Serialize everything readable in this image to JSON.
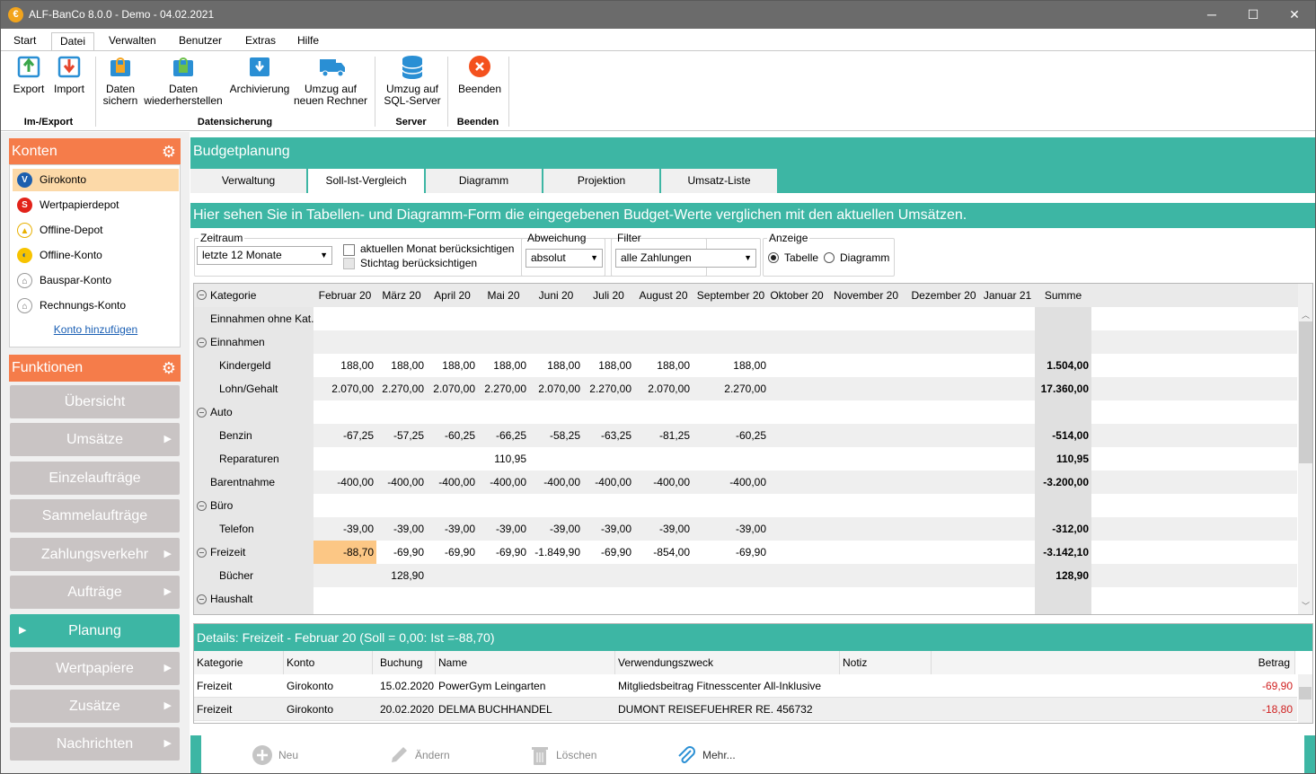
{
  "window": {
    "title": "ALF-BanCo 8.0.0 - Demo  -  04.02.2021",
    "min": "─",
    "max": "☐",
    "close": "✕"
  },
  "menu": [
    "Start",
    "Datei",
    "Verwalten",
    "Benutzer",
    "Extras",
    "Hilfe"
  ],
  "ribbon": {
    "export": "Export",
    "import": "Import",
    "sichern1": "Daten",
    "sichern2": "sichern",
    "wieder1": "Daten",
    "wieder2": "wiederherstellen",
    "archiv": "Archivierung",
    "umzug1": "Umzug auf",
    "umzug2": "neuen Rechner",
    "sql1": "Umzug auf",
    "sql2": "SQL-Server",
    "beenden": "Beenden",
    "groups": {
      "imexport": "Im-/Export",
      "datensicherung": "Datensicherung",
      "server": "Server",
      "beenden": "Beenden"
    }
  },
  "konten": {
    "title": "Konten",
    "items": [
      "Girokonto",
      "Wertpapierdepot",
      "Offline-Depot",
      "Offline-Konto",
      "Bauspar-Konto",
      "Rechnungs-Konto"
    ],
    "add": "Konto hinzufügen"
  },
  "funktionen": {
    "title": "Funktionen",
    "items": [
      "Übersicht",
      "Umsätze",
      "Einzelaufträge",
      "Sammelaufträge",
      "Zahlungsverkehr",
      "Aufträge",
      "Planung",
      "Wertpapiere",
      "Zusätze",
      "Nachrichten"
    ]
  },
  "budget": {
    "title": "Budgetplanung",
    "tabs": [
      "Verwaltung",
      "Soll-Ist-Vergleich",
      "Diagramm",
      "Projektion",
      "Umsatz-Liste"
    ],
    "info": "Hier sehen Sie in Tabellen- und Diagramm-Form die eingegebenen Budget-Werte verglichen mit den aktuellen Umsätzen."
  },
  "filters": {
    "zeitraum_label": "Zeitraum",
    "zeitraum_value": "letzte 12 Monate",
    "chk_monat": "aktuellen Monat berücksichtigen",
    "chk_stichtag": "Stichtag berücksichtigen",
    "abweichung_label": "Abweichung",
    "abweichung_value": "absolut",
    "filter_label": "Filter",
    "filter_value": "alle Zahlungen",
    "anzeige_label": "Anzeige",
    "radio_tabelle": "Tabelle",
    "radio_diagramm": "Diagramm"
  },
  "grid": {
    "headers": [
      "Kategorie",
      "Februar 20",
      "März 20",
      "April 20",
      "Mai 20",
      "Juni 20",
      "Juli 20",
      "August 20",
      "September 20",
      "Oktober 20",
      "November 20",
      "Dezember 20",
      "Januar 21",
      "Summe"
    ],
    "rows": [
      {
        "label": "Einnahmen ohne Kat.",
        "indent": 0,
        "group": false,
        "values": [
          "",
          "",
          "",
          "",
          "",
          "",
          "",
          "",
          "",
          "",
          "",
          "",
          ""
        ]
      },
      {
        "label": "Einnahmen",
        "indent": 0,
        "group": true,
        "values": [
          "",
          "",
          "",
          "",
          "",
          "",
          "",
          "",
          "",
          "",
          "",
          "",
          ""
        ]
      },
      {
        "label": "Kindergeld",
        "indent": 1,
        "group": false,
        "values": [
          "188,00",
          "188,00",
          "188,00",
          "188,00",
          "188,00",
          "188,00",
          "188,00",
          "188,00",
          "",
          "",
          "",
          "",
          "1.504,00"
        ]
      },
      {
        "label": "Lohn/Gehalt",
        "indent": 1,
        "group": false,
        "values": [
          "2.070,00",
          "2.270,00",
          "2.070,00",
          "2.270,00",
          "2.070,00",
          "2.270,00",
          "2.070,00",
          "2.270,00",
          "",
          "",
          "",
          "",
          "17.360,00"
        ]
      },
      {
        "label": "Auto",
        "indent": 0,
        "group": true,
        "values": [
          "",
          "",
          "",
          "",
          "",
          "",
          "",
          "",
          "",
          "",
          "",
          "",
          ""
        ]
      },
      {
        "label": "Benzin",
        "indent": 1,
        "group": false,
        "values": [
          "-67,25",
          "-57,25",
          "-60,25",
          "-66,25",
          "-58,25",
          "-63,25",
          "-81,25",
          "-60,25",
          "",
          "",
          "",
          "",
          "-514,00"
        ]
      },
      {
        "label": "Reparaturen",
        "indent": 1,
        "group": false,
        "values": [
          "",
          "",
          "",
          "110,95",
          "",
          "",
          "",
          "",
          "",
          "",
          "",
          "",
          "110,95"
        ]
      },
      {
        "label": "Barentnahme",
        "indent": 0,
        "group": false,
        "values": [
          "-400,00",
          "-400,00",
          "-400,00",
          "-400,00",
          "-400,00",
          "-400,00",
          "-400,00",
          "-400,00",
          "",
          "",
          "",
          "",
          "-3.200,00"
        ]
      },
      {
        "label": "Büro",
        "indent": 0,
        "group": true,
        "values": [
          "",
          "",
          "",
          "",
          "",
          "",
          "",
          "",
          "",
          "",
          "",
          "",
          ""
        ]
      },
      {
        "label": "Telefon",
        "indent": 1,
        "group": false,
        "values": [
          "-39,00",
          "-39,00",
          "-39,00",
          "-39,00",
          "-39,00",
          "-39,00",
          "-39,00",
          "-39,00",
          "",
          "",
          "",
          "",
          "-312,00"
        ]
      },
      {
        "label": "Freizeit",
        "indent": 0,
        "group": true,
        "values": [
          "-88,70",
          "-69,90",
          "-69,90",
          "-69,90",
          "-1.849,90",
          "-69,90",
          "-854,00",
          "-69,90",
          "",
          "",
          "",
          "",
          "-3.142,10"
        ]
      },
      {
        "label": "Bücher",
        "indent": 1,
        "group": false,
        "values": [
          "",
          "128,90",
          "",
          "",
          "",
          "",
          "",
          "",
          "",
          "",
          "",
          "",
          "128,90"
        ]
      },
      {
        "label": "Haushalt",
        "indent": 0,
        "group": true,
        "values": [
          "",
          "",
          "",
          "",
          "",
          "",
          "",
          "",
          "",
          "",
          "",
          "",
          ""
        ]
      }
    ],
    "highlight_color": "#fcc785"
  },
  "details": {
    "title": "Details: Freizeit - Februar 20  (Soll = 0,00: Ist =-88,70)",
    "headers": [
      "Kategorie",
      "Konto",
      "Buchung",
      "Name",
      "Verwendungszweck",
      "Notiz",
      "Betrag"
    ],
    "rows": [
      [
        "Freizeit",
        "Girokonto",
        "15.02.2020",
        "PowerGym Leingarten",
        "Mitgliedsbeitrag Fitnesscenter All-Inklusive",
        "",
        "-69,90"
      ],
      [
        "Freizeit",
        "Girokonto",
        "20.02.2020",
        "DELMA BUCHHANDEL",
        "DUMONT REISEFUEHRER RE. 456732",
        "",
        "-18,80"
      ]
    ],
    "negative_color": "#d02020"
  },
  "actions": {
    "neu": "Neu",
    "aendern": "Ändern",
    "loeschen": "Löschen",
    "mehr": "Mehr..."
  },
  "colors": {
    "teal": "#3db6a4",
    "orange": "#f57c4a",
    "titlebar": "#6b6b6b"
  }
}
